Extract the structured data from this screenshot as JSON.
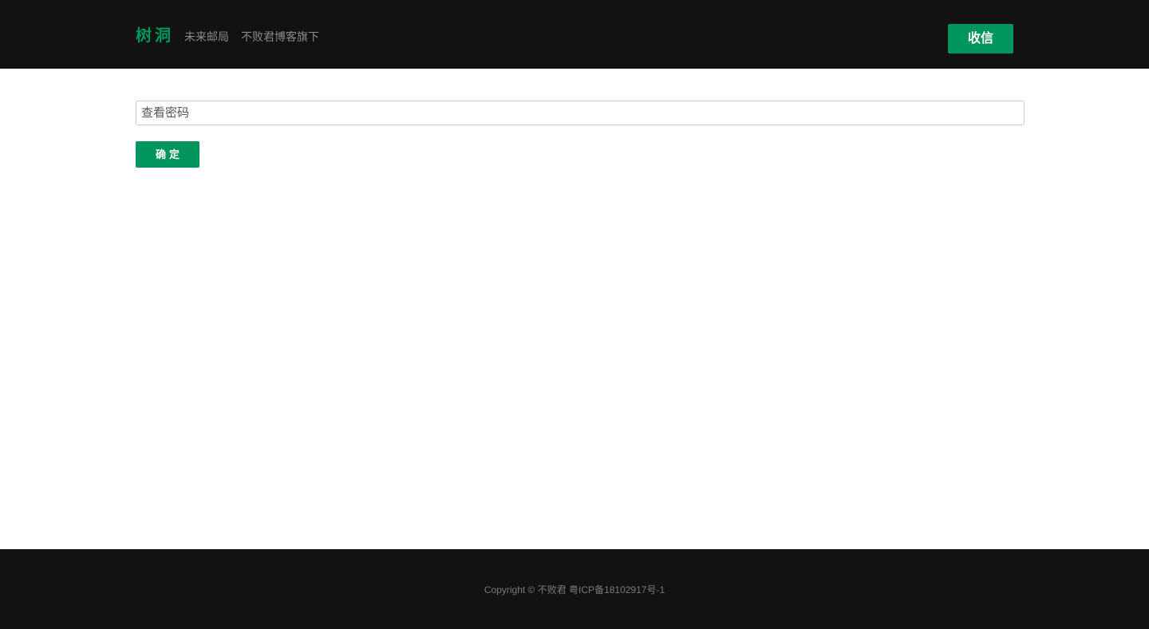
{
  "header": {
    "brand": "树洞",
    "taglines": [
      "未来邮局",
      "不败君博客旗下"
    ],
    "receive_label": "收信"
  },
  "form": {
    "password_placeholder": "查看密码",
    "password_value": "",
    "confirm_label": "确定"
  },
  "footer": {
    "copyright": "Copyright © 不败君 粤ICP备18102917号-1"
  },
  "colors": {
    "accent": "#00955c",
    "header_bg": "#121212",
    "footer_bg": "#121212"
  }
}
